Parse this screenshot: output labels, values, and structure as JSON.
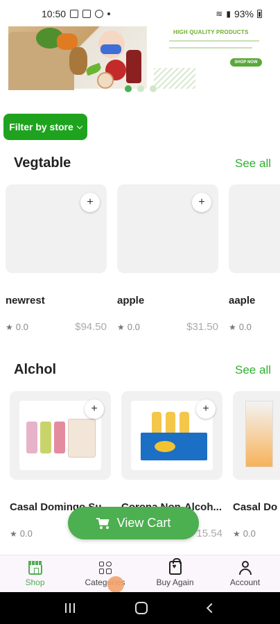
{
  "status_bar": {
    "time": "10:50",
    "battery": "93%"
  },
  "banner": {
    "title": "HIGH QUALITY PRODUCTS",
    "cta": "SHOP NOW",
    "active_slide": 1,
    "slide_count": 3
  },
  "filter": {
    "label": "Filter by store"
  },
  "sections": [
    {
      "title": "Vegtable",
      "see_all": "See all",
      "products": [
        {
          "name": "newrest",
          "rating": "0.0",
          "price": "$94.50"
        },
        {
          "name": "apple",
          "rating": "0.0",
          "price": "$31.50"
        },
        {
          "name": "aaple",
          "rating": "0.0",
          "price": ""
        }
      ]
    },
    {
      "title": "Alchol",
      "see_all": "See all",
      "products": [
        {
          "name": "Casal Domingo Su",
          "rating": "0.0",
          "price": ""
        },
        {
          "name": "Corona Non-Alcoh...",
          "rating": "",
          "price": "15.54"
        },
        {
          "name": "Casal Do",
          "rating": "0.0",
          "price": ""
        }
      ]
    }
  ],
  "add_symbol": "+",
  "view_cart": {
    "label": "View Cart"
  },
  "bottom_nav": {
    "items": [
      {
        "label": "Shop",
        "icon": "shop-icon",
        "active": true
      },
      {
        "label": "Categories",
        "icon": "categories-icon",
        "active": false
      },
      {
        "label": "Buy Again",
        "icon": "buy-again-icon",
        "active": false
      },
      {
        "label": "Account",
        "icon": "account-icon",
        "active": false
      }
    ]
  },
  "colors": {
    "accent": "#4caf50",
    "filter": "#1fa31f",
    "see_all": "#2fb02f"
  }
}
